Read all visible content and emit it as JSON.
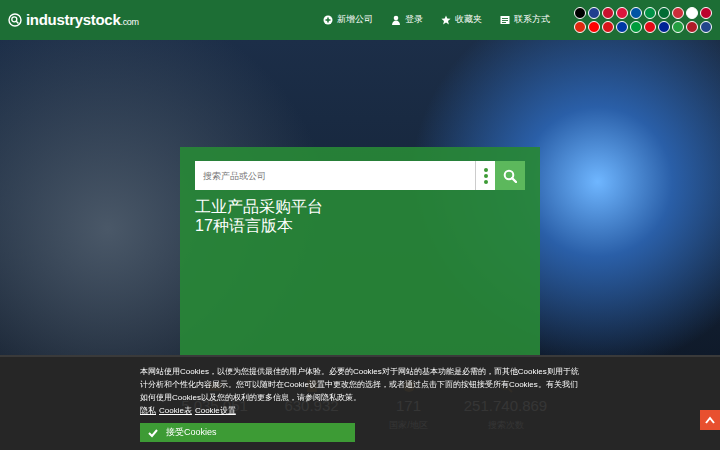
{
  "header": {
    "logo": "industrystock",
    "logo_suffix": ".com",
    "nav": [
      "新增公司",
      "登录",
      "收藏夹",
      "联系方式"
    ]
  },
  "languages": [
    {
      "color": "#000000"
    },
    {
      "color": "#1f3f8f"
    },
    {
      "color": "#c8102e"
    },
    {
      "color": "#dc143c"
    },
    {
      "color": "#0055a4"
    },
    {
      "color": "#009246"
    },
    {
      "color": "#006c35"
    },
    {
      "color": "#cd2e3a"
    },
    {
      "color": "#ffffff"
    },
    {
      "color": "#bc002d"
    },
    {
      "color": "#de2910"
    },
    {
      "color": "#ff0000"
    },
    {
      "color": "#d7141a"
    },
    {
      "color": "#0039a6"
    },
    {
      "color": "#009c3b"
    },
    {
      "color": "#e30a17"
    },
    {
      "color": "#002395"
    },
    {
      "color": "#239f40"
    },
    {
      "color": "#ae1c28"
    },
    {
      "color": "#21468b"
    }
  ],
  "search": {
    "placeholder": "搜索产品或公司",
    "headline": [
      "工业产品采购平台",
      "17种语言版本"
    ]
  },
  "stats": [
    {
      "value": "5.035.051"
    },
    {
      "value": "630.932"
    },
    {
      "value": "171",
      "label": "国家/地区"
    },
    {
      "value": "251.740.869",
      "label": "搜索次数"
    }
  ],
  "cookie": {
    "text": "本网站使用Cookies，以便为您提供最佳的用户体验。必要的Cookies对于网站的基本功能是必需的，而其他Cookies则用于统计分析和个性化内容展示。您可以随时在Cookie设置中更改您的选择，或者通过点击下面的按钮接受所有Cookies。有关我们如何使用Cookies以及您的权利的更多信息，请参阅隐私政策。",
    "links": [
      "隐私",
      "Cookie表",
      "Cookie设置"
    ],
    "accept": "接受Cookies"
  }
}
